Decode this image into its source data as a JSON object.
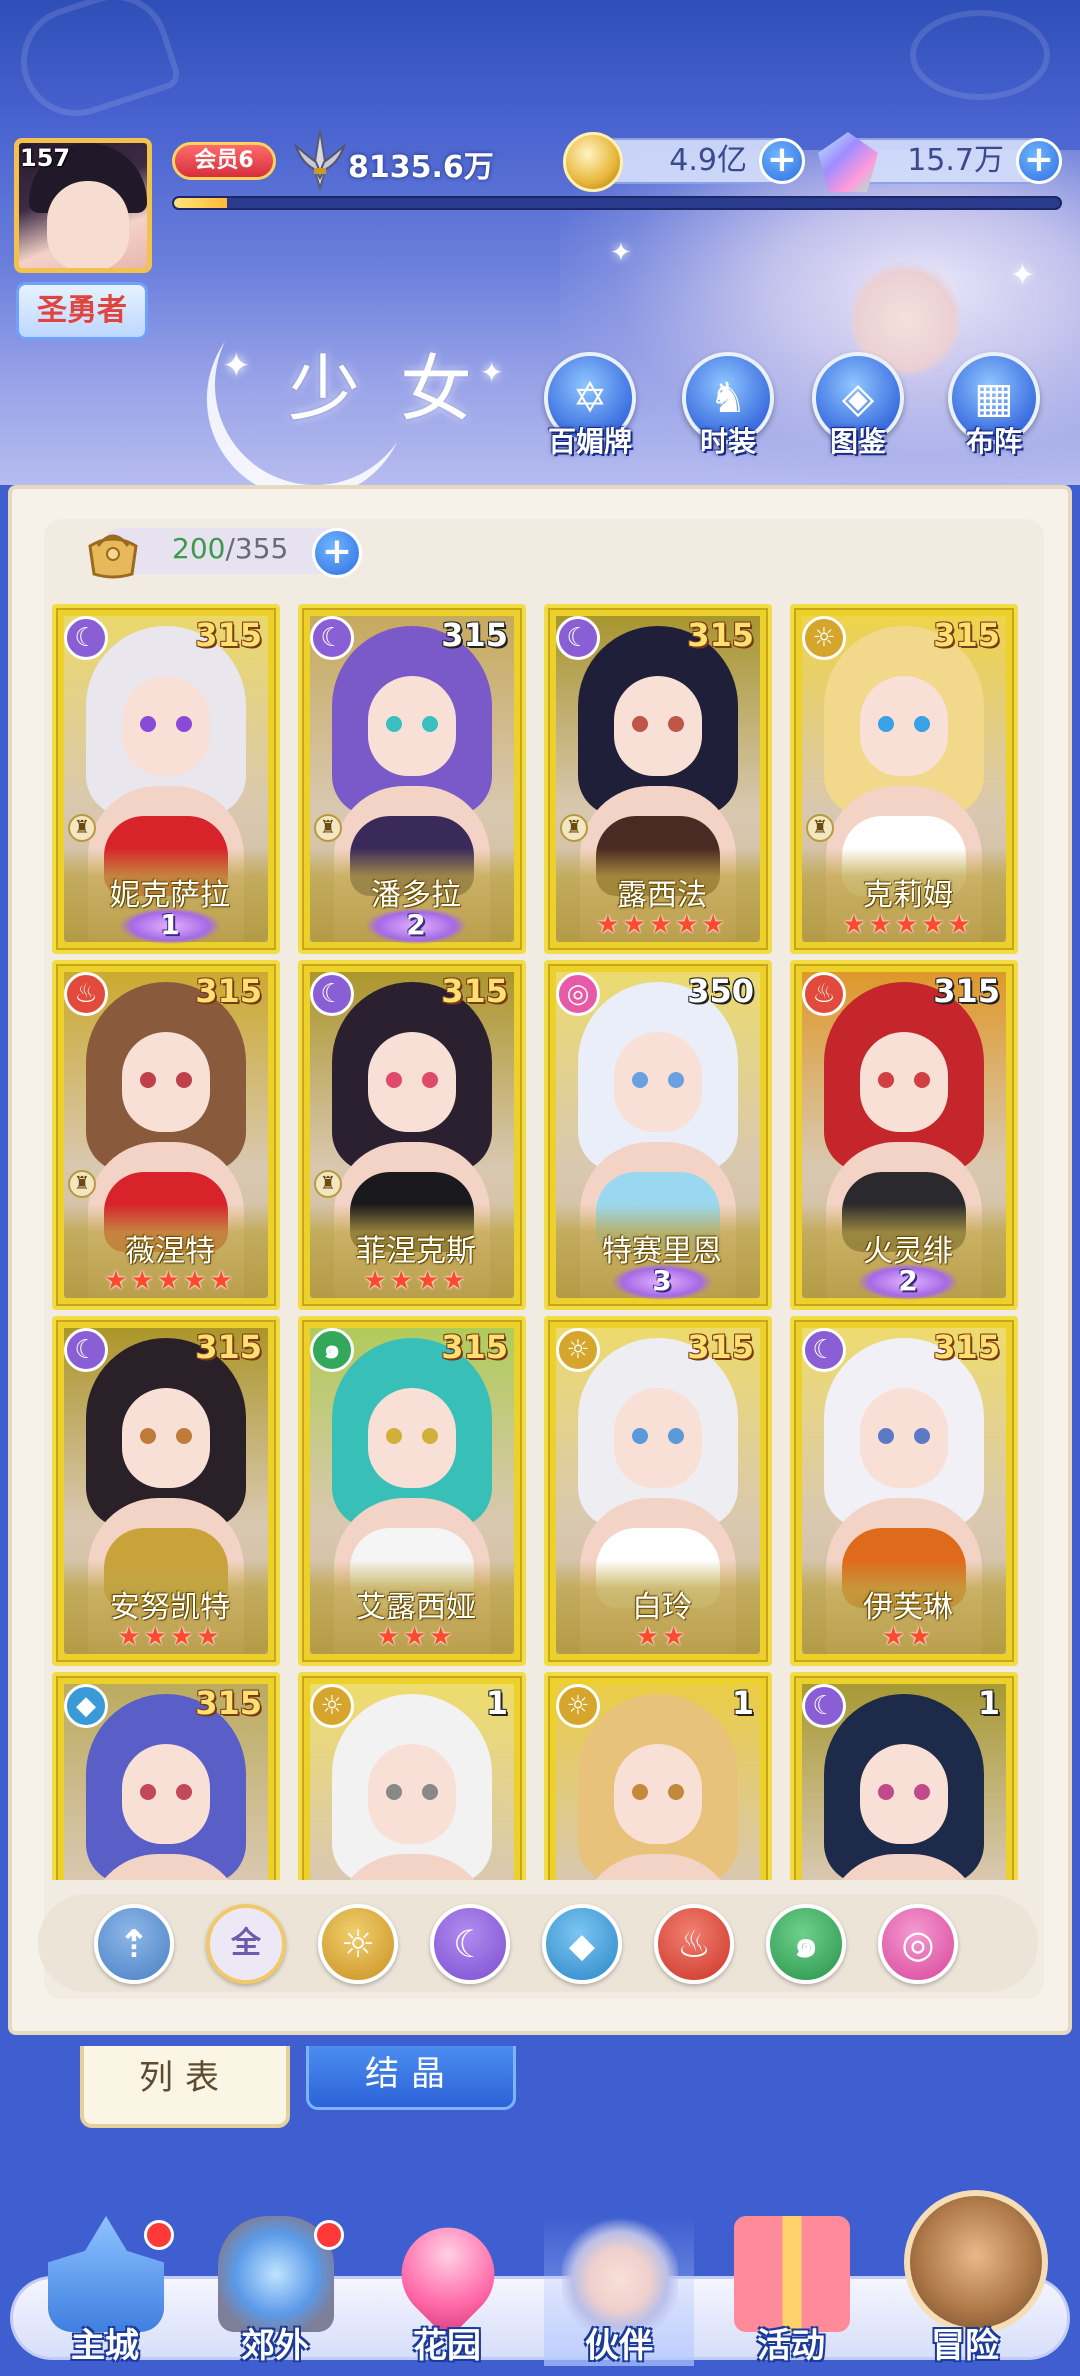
{
  "player": {
    "level": "157",
    "title": "圣勇者",
    "vip": "会员6",
    "power": "8135.6万",
    "exp_fraction": 0.06
  },
  "currencies": {
    "gold": "4.9亿",
    "gems": "15.7万",
    "plus": "+"
  },
  "page_title": "少女",
  "top_buttons": [
    {
      "label": "百媚牌",
      "icon": "star-card-icon"
    },
    {
      "label": "时装",
      "icon": "outfit-icon"
    },
    {
      "label": "图鉴",
      "icon": "book-icon"
    },
    {
      "label": "布阵",
      "icon": "formation-grid-icon"
    }
  ],
  "inventory": {
    "current": "200",
    "total": "/355",
    "plus": "+"
  },
  "cards": [
    {
      "name": "妮克萨拉",
      "level": "315",
      "element": "moon",
      "stars": "",
      "wing": "1"
    },
    {
      "name": "潘多拉",
      "level": "315",
      "element": "moon",
      "stars": "",
      "wing": "2"
    },
    {
      "name": "露西法",
      "level": "315",
      "element": "moon",
      "stars": "★★★★★",
      "wing": ""
    },
    {
      "name": "克莉姆",
      "level": "315",
      "element": "sun",
      "stars": "★★★★★",
      "wing": ""
    },
    {
      "name": "薇涅特",
      "level": "315",
      "element": "fire",
      "stars": "★★★★★",
      "wing": ""
    },
    {
      "name": "菲涅克斯",
      "level": "315",
      "element": "moon",
      "stars": "★★★★",
      "wing": ""
    },
    {
      "name": "特赛里恩",
      "level": "350",
      "element": "pink",
      "stars": "",
      "wing": "3"
    },
    {
      "name": "火灵绯",
      "level": "315",
      "element": "fire",
      "stars": "",
      "wing": "2"
    },
    {
      "name": "安努凯特",
      "level": "315",
      "element": "moon",
      "stars": "★★★★",
      "wing": ""
    },
    {
      "name": "艾露西娅",
      "level": "315",
      "element": "wind",
      "stars": "★★★",
      "wing": ""
    },
    {
      "name": "白玲",
      "level": "315",
      "element": "sun",
      "stars": "★★",
      "wing": ""
    },
    {
      "name": "伊芙琳",
      "level": "315",
      "element": "moon",
      "stars": "★★",
      "wing": ""
    },
    {
      "name": "",
      "level": "315",
      "element": "water",
      "stars": "",
      "wing": ""
    },
    {
      "name": "",
      "level": "1",
      "element": "sun",
      "stars": "",
      "wing": ""
    },
    {
      "name": "",
      "level": "1",
      "element": "sun",
      "stars": "",
      "wing": ""
    },
    {
      "name": "",
      "level": "1",
      "element": "moon",
      "stars": "",
      "wing": ""
    }
  ],
  "filters": [
    {
      "id": "sort",
      "label": ""
    },
    {
      "id": "all",
      "label": "全"
    },
    {
      "id": "sun",
      "label": "☼"
    },
    {
      "id": "moon",
      "label": "☾"
    },
    {
      "id": "water",
      "label": "💧"
    },
    {
      "id": "fire",
      "label": "♨"
    },
    {
      "id": "wind",
      "label": "๑"
    },
    {
      "id": "pink",
      "label": "◎"
    }
  ],
  "subtabs": {
    "list": "列表",
    "crystal": "结晶"
  },
  "nav": [
    {
      "label": "主城",
      "badge": true
    },
    {
      "label": "郊外",
      "badge": true
    },
    {
      "label": "花园",
      "badge": false
    },
    {
      "label": "伙伴",
      "badge": false
    },
    {
      "label": "活动",
      "badge": false
    },
    {
      "label": "冒险",
      "badge": false
    }
  ],
  "colors": {
    "card_gold": "#ecd12a",
    "moon": "#8a5fd6",
    "sun": "#d6a52c",
    "fire": "#e24b3b",
    "water": "#3a9ad8",
    "wind": "#33a85a",
    "pink": "#e75aa8",
    "accent_blue": "#2e6fe0"
  }
}
